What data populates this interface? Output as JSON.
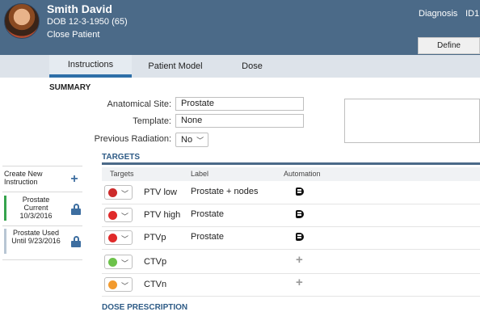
{
  "patient": {
    "name": "Smith David",
    "dob": "DOB 12-3-1950 (65)",
    "close_label": "Close Patient"
  },
  "header": {
    "diagnosis_label": "Diagnosis",
    "id_label": "ID1:"
  },
  "define_label": "Define",
  "tabs": [
    {
      "label": "Instructions",
      "active": true
    },
    {
      "label": "Patient Model",
      "active": false
    },
    {
      "label": "Dose",
      "active": false
    }
  ],
  "sidebar": {
    "create_label": "Create New Instruction",
    "instructions": [
      {
        "text": "Prostate Current 10/3/2016",
        "status_color": "#35a34d"
      },
      {
        "text": "Prostate Used Until 9/23/2016",
        "status_color": "#b8c6d4"
      }
    ]
  },
  "summary": {
    "title": "SUMMARY",
    "anatomical_site_label": "Anatomical Site:",
    "anatomical_site_value": "Prostate",
    "template_label": "Template:",
    "template_value": "None",
    "previous_radiation_label": "Previous Radiation:",
    "previous_radiation_value": "No"
  },
  "targets": {
    "title": "TARGETS",
    "columns": [
      "Targets",
      "Label",
      "Automation"
    ],
    "rows": [
      {
        "name": "PTV low",
        "label": "Prostate + nodes",
        "color": "#cc2a2a",
        "automation": "automation-icon"
      },
      {
        "name": "PTV high",
        "label": "Prostate",
        "color": "#e02a2a",
        "automation": "automation-icon"
      },
      {
        "name": "PTVp",
        "label": "Prostate",
        "color": "#e02a2a",
        "automation": "automation-icon"
      },
      {
        "name": "CTVp",
        "label": "",
        "color": "#6cc24a",
        "automation": "add-icon"
      },
      {
        "name": "CTVn",
        "label": "",
        "color": "#f29a2e",
        "automation": "add-icon"
      }
    ]
  },
  "dose_prescription": {
    "title": "DOSE PRESCRIPTION"
  },
  "colors": {
    "header_bg": "#4b6a88",
    "accent": "#2e6fa8",
    "tab_bar_bg": "#dde3ea"
  }
}
